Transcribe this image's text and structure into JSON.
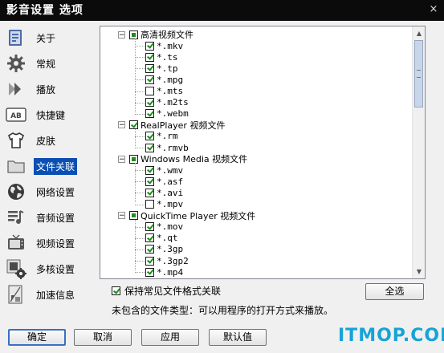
{
  "window": {
    "title": "影音设置 选项",
    "close_glyph": "×"
  },
  "sidebar": {
    "items": [
      {
        "label": "关于",
        "icon": "about-icon"
      },
      {
        "label": "常规",
        "icon": "gear-icon"
      },
      {
        "label": "播放",
        "icon": "play-icon"
      },
      {
        "label": "快捷键",
        "icon": "keyboard-icon"
      },
      {
        "label": "皮肤",
        "icon": "tshirt-icon"
      },
      {
        "label": "文件关联",
        "icon": "folder-icon",
        "selected": true
      },
      {
        "label": "网络设置",
        "icon": "globe-icon"
      },
      {
        "label": "音频设置",
        "icon": "audio-icon"
      },
      {
        "label": "视频设置",
        "icon": "tv-icon"
      },
      {
        "label": "多核设置",
        "icon": "multicore-icon"
      },
      {
        "label": "加速信息",
        "icon": "accelerate-icon"
      }
    ]
  },
  "tree": {
    "groups": [
      {
        "name": "高清视频文件",
        "state": "partial",
        "items": [
          {
            "ext": "*.mkv",
            "checked": true
          },
          {
            "ext": "*.ts",
            "checked": true
          },
          {
            "ext": "*.tp",
            "checked": true
          },
          {
            "ext": "*.mpg",
            "checked": true
          },
          {
            "ext": "*.mts",
            "checked": false
          },
          {
            "ext": "*.m2ts",
            "checked": true
          },
          {
            "ext": "*.webm",
            "checked": true
          }
        ]
      },
      {
        "name": "RealPlayer 视频文件",
        "state": "checked",
        "items": [
          {
            "ext": "*.rm",
            "checked": true
          },
          {
            "ext": "*.rmvb",
            "checked": true
          }
        ]
      },
      {
        "name": "Windows Media 视频文件",
        "state": "partial",
        "items": [
          {
            "ext": "*.wmv",
            "checked": true
          },
          {
            "ext": "*.asf",
            "checked": true
          },
          {
            "ext": "*.avi",
            "checked": true
          },
          {
            "ext": "*.mpv",
            "checked": false
          }
        ]
      },
      {
        "name": "QuickTime Player 视频文件",
        "state": "partial",
        "items": [
          {
            "ext": "*.mov",
            "checked": true
          },
          {
            "ext": "*.qt",
            "checked": true
          },
          {
            "ext": "*.3gp",
            "checked": true
          },
          {
            "ext": "*.3gp2",
            "checked": true
          },
          {
            "ext": "*.mp4",
            "checked": true
          }
        ]
      }
    ]
  },
  "options": {
    "keep_assoc_label": "保持常见文件格式关联",
    "keep_assoc_checked": true,
    "select_all_label": "全选",
    "info_text": "未包含的文件类型：可以用程序的打开方式来播放。"
  },
  "buttons": {
    "ok": "确定",
    "cancel": "取消",
    "apply": "应用",
    "defaults": "默认值"
  },
  "watermark": "ITMOP.COM",
  "colors": {
    "selected_bg": "#0a4fb4",
    "check_green": "#1e8a1e",
    "watermark": "#16a3d6"
  }
}
